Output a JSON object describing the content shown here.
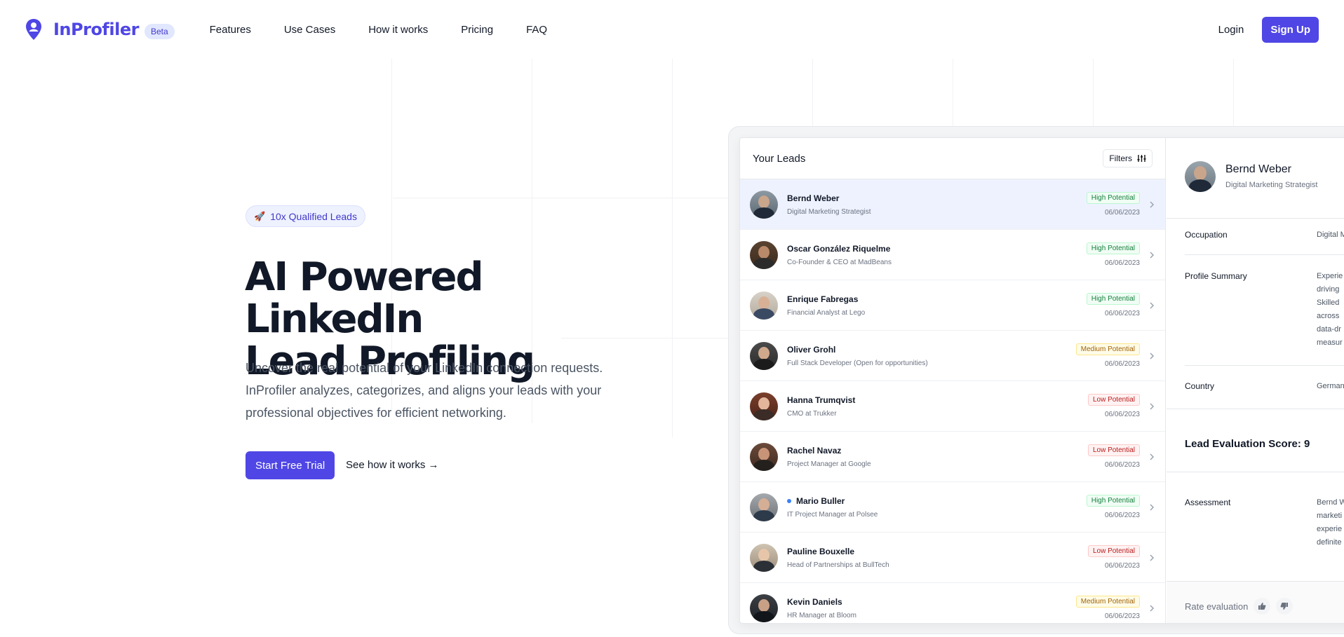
{
  "header": {
    "brand_name": "InProfiler",
    "beta_label": "Beta",
    "nav": [
      "Features",
      "Use Cases",
      "How it works",
      "Pricing",
      "FAQ"
    ],
    "login_label": "Login",
    "signup_label": "Sign Up"
  },
  "hero": {
    "pill_label": "10x Qualified Leads",
    "title_line1": "AI Powered LinkedIn",
    "title_line2": "Lead Profiling",
    "description": "Uncover the real potential of your LinkedIn connection requests. InProfiler analyzes, categorizes, and aligns your leads with your professional objectives for efficient networking.",
    "cta_label": "Start Free Trial",
    "secondary_label": "See how it works →"
  },
  "app": {
    "leads_title": "Your Leads",
    "filters_label": "Filters",
    "leads": [
      {
        "name": "Bernd Weber",
        "role": "Digital Marketing Strategist",
        "potential": "High Potential",
        "level": "high",
        "date": "06/06/2023",
        "unread": false
      },
      {
        "name": "Oscar González Riquelme",
        "role": "Co-Founder & CEO at MadBeans",
        "potential": "High Potential",
        "level": "high",
        "date": "06/06/2023",
        "unread": false
      },
      {
        "name": "Enrique Fabregas",
        "role": "Financial Analyst at Lego",
        "potential": "High Potential",
        "level": "high",
        "date": "06/06/2023",
        "unread": false
      },
      {
        "name": "Oliver Grohl",
        "role": "Full Stack Developer (Open for opportunities)",
        "potential": "Medium Potential",
        "level": "medium",
        "date": "06/06/2023",
        "unread": false
      },
      {
        "name": "Hanna Trumqvist",
        "role": "CMO at Trukker",
        "potential": "Low Potential",
        "level": "low",
        "date": "06/06/2023",
        "unread": false
      },
      {
        "name": "Rachel Navaz",
        "role": "Project Manager at Google",
        "potential": "Low Potential",
        "level": "low",
        "date": "06/06/2023",
        "unread": false
      },
      {
        "name": "Mario Buller",
        "role": "IT Project Manager at Polsee",
        "potential": "High Potential",
        "level": "high",
        "date": "06/06/2023",
        "unread": true
      },
      {
        "name": "Pauline Bouxelle",
        "role": "Head of Partnerships at BullTech",
        "potential": "Low Potential",
        "level": "low",
        "date": "06/06/2023",
        "unread": false
      },
      {
        "name": "Kevin Daniels",
        "role": "HR Manager at Bloom",
        "potential": "Medium Potential",
        "level": "medium",
        "date": "06/06/2023",
        "unread": false
      }
    ],
    "detail": {
      "name": "Bernd Weber",
      "role": "Digital Marketing Strategist",
      "occupation_label": "Occupation",
      "occupation_value": "Digital M",
      "summary_label": "Profile Summary",
      "summary_lines": [
        "Experie",
        "driving",
        "Skilled",
        "across",
        "data-dr",
        "measur"
      ],
      "country_label": "Country",
      "country_value": "German",
      "score_label": "Lead Evaluation Score: 9",
      "assessment_label": "Assessment",
      "assessment_lines": [
        "Bernd W",
        "marketi",
        "experie",
        "definite"
      ],
      "rate_label": "Rate evaluation"
    }
  },
  "colors": {
    "brand": "#4f46e5",
    "high": "#15803d",
    "medium": "#a16207",
    "low": "#b91c1c"
  }
}
